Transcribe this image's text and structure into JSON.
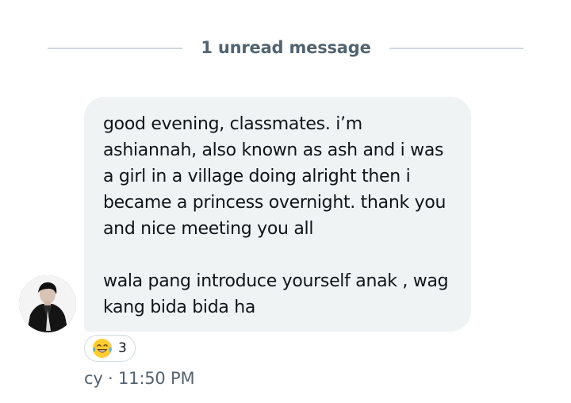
{
  "divider": {
    "label": "1 unread message"
  },
  "message": {
    "paragraph1": "good evening, classmates. i’m ashiannah, also known as ash and i was a girl in a village doing alright then i became a princess overnight. thank you and nice meeting you all",
    "paragraph2": "wala pang introduce yourself anak , wag kang bida bida ha"
  },
  "reaction": {
    "emoji": "laughing-with-tears-icon",
    "count": "3"
  },
  "meta": {
    "sender_time": "cy · 11:50 PM"
  },
  "colors": {
    "bubble_bg": "#eff3f4",
    "secondary_text": "#536471",
    "divider": "#cfd9de",
    "emoji_yellow": "#ffcc33"
  }
}
